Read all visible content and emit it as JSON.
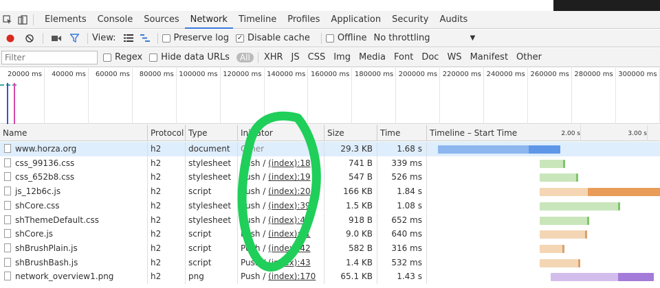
{
  "devtools": {
    "tabs": [
      "Elements",
      "Console",
      "Sources",
      "Network",
      "Timeline",
      "Profiles",
      "Application",
      "Security",
      "Audits"
    ],
    "active_tab": "Network"
  },
  "toolbar": {
    "view_label": "View:",
    "preserve_log": "Preserve log",
    "disable_cache": "Disable cache",
    "offline": "Offline",
    "throttling": "No throttling"
  },
  "filterbar": {
    "placeholder": "Filter",
    "regex": "Regex",
    "hide_data_urls": "Hide data URLs",
    "all": "All",
    "types": [
      "XHR",
      "JS",
      "CSS",
      "Img",
      "Media",
      "Font",
      "Doc",
      "WS",
      "Manifest",
      "Other"
    ]
  },
  "overview": {
    "ticks": [
      "20000 ms",
      "40000 ms",
      "60000 ms",
      "80000 ms",
      "100000 ms",
      "120000 ms",
      "140000 ms",
      "160000 ms",
      "180000 ms",
      "200000 ms",
      "220000 ms",
      "240000 ms",
      "260000 ms",
      "280000 ms",
      "300000 ms"
    ]
  },
  "table": {
    "headers": {
      "name": "Name",
      "protocol": "Protocol",
      "type": "Type",
      "initiator": "Initiator",
      "size": "Size",
      "time": "Time",
      "timeline": "Timeline – Start Time",
      "t1": "2.00 s",
      "t2": "3.00 s"
    },
    "rows": [
      {
        "name": "www.horza.org",
        "protocol": "h2",
        "type": "document",
        "push": "",
        "initiator": "Other",
        "size": "29.3 KB",
        "time": "1.68 s"
      },
      {
        "name": "css_99136.css",
        "protocol": "h2",
        "type": "stylesheet",
        "push": "Push / ",
        "initiator": "(index):18",
        "size": "741 B",
        "time": "339 ms"
      },
      {
        "name": "css_652b8.css",
        "protocol": "h2",
        "type": "stylesheet",
        "push": "Push / ",
        "initiator": "(index):19",
        "size": "547 B",
        "time": "526 ms"
      },
      {
        "name": "js_12b6c.js",
        "protocol": "h2",
        "type": "script",
        "push": "Push / ",
        "initiator": "(index):20",
        "size": "166 KB",
        "time": "1.84 s"
      },
      {
        "name": "shCore.css",
        "protocol": "h2",
        "type": "stylesheet",
        "push": "Push / ",
        "initiator": "(index):39",
        "size": "1.5 KB",
        "time": "1.08 s"
      },
      {
        "name": "shThemeDefault.css",
        "protocol": "h2",
        "type": "stylesheet",
        "push": "Push / ",
        "initiator": "(index):40",
        "size": "918 B",
        "time": "652 ms"
      },
      {
        "name": "shCore.js",
        "protocol": "h2",
        "type": "script",
        "push": "Push / ",
        "initiator": "(index):41",
        "size": "9.0 KB",
        "time": "640 ms"
      },
      {
        "name": "shBrushPlain.js",
        "protocol": "h2",
        "type": "script",
        "push": "Push / ",
        "initiator": "(index):42",
        "size": "582 B",
        "time": "316 ms"
      },
      {
        "name": "shBrushBash.js",
        "protocol": "h2",
        "type": "script",
        "push": "Push / ",
        "initiator": "(index):43",
        "size": "1.4 KB",
        "time": "532 ms"
      },
      {
        "name": "network_overview1.png",
        "protocol": "h2",
        "type": "png",
        "push": "Push / ",
        "initiator": "(index):170",
        "size": "65.1 KB",
        "time": "1.43 s"
      }
    ]
  },
  "colors": {
    "document_bar": "#8db6ee",
    "stylesheet_bar": "#c9e6bb",
    "script_bar": "#f4d6b4",
    "image_bar": "#d3bdec",
    "annotation": "#1fcf5a",
    "accent": "#3879d9"
  }
}
